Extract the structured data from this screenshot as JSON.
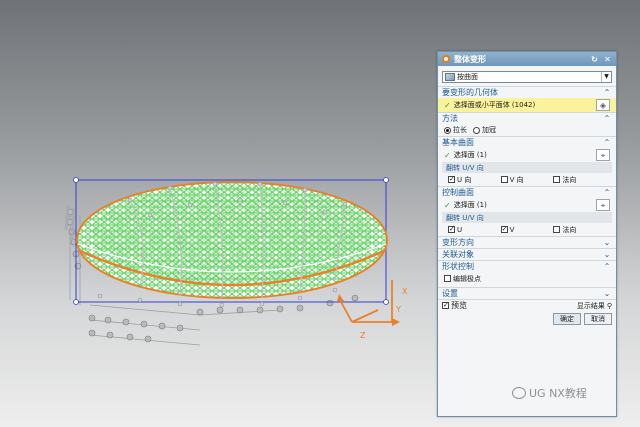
{
  "dialog": {
    "title": "整体变形",
    "type_select": "按曲面",
    "sections": {
      "geometry": {
        "header": "要变形的几何体",
        "selection": "选择面或小平面体 (1042)"
      },
      "method": {
        "header": "方法",
        "options": [
          "拉长",
          "加冠"
        ],
        "selected": "拉长"
      },
      "base_surface": {
        "header": "基本曲面",
        "selection": "选择面 (1)",
        "flip_header": "翻转 U/V 向",
        "checkboxes": [
          {
            "label": "U 向",
            "checked": true
          },
          {
            "label": "V 向",
            "checked": false
          },
          {
            "label": "法向",
            "checked": false
          }
        ]
      },
      "control_surface": {
        "header": "控制曲面",
        "selection": "选择面 (1)",
        "flip_header": "翻转 U/V 向",
        "checkboxes": [
          {
            "label": "U",
            "checked": true
          },
          {
            "label": "V",
            "checked": true
          },
          {
            "label": "法向",
            "checked": false
          }
        ]
      },
      "deform_direction": {
        "header": "变形方向"
      },
      "associate": {
        "header": "关联对象"
      },
      "shape_control": {
        "header": "形状控制",
        "edit_poles": "编辑极点",
        "edit_poles_checked": false
      },
      "settings": {
        "header": "设置"
      }
    },
    "footer": {
      "preview_label": "预览",
      "preview_checked": true,
      "show_result": "显示结果",
      "ok": "确定",
      "cancel": "取消"
    }
  },
  "watermark": {
    "text": "UG NX教程"
  },
  "colors": {
    "title_bar": "#7aa0c1",
    "header_text": "#1c5a95",
    "highlight": "#fbf29c",
    "mesh_green": "#3ec63e",
    "mesh_white": "#ffffff",
    "edge_orange": "#e8822a",
    "box_blue": "#2f3fd8"
  },
  "viewport": {
    "axis_labels": [
      "X",
      "Y",
      "Z"
    ]
  }
}
